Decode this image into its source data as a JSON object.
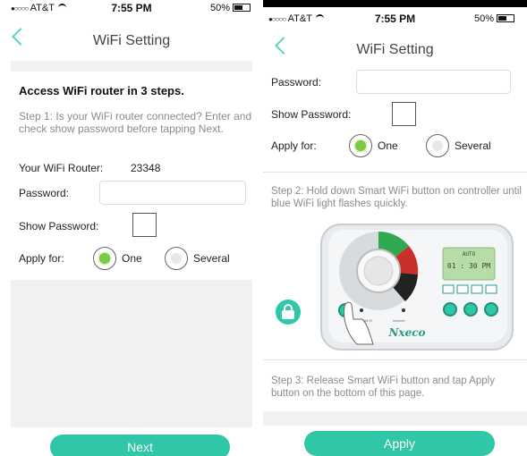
{
  "left": {
    "status": {
      "carrier": "AT&T",
      "time": "7:55 PM",
      "battery": "50%"
    },
    "title": "WiFi Setting",
    "heading": "Access WiFi router in 3 steps.",
    "step1": "Step 1: Is your WiFi router connected? Enter and check show password before tapping Next.",
    "router_label": "Your WiFi Router:",
    "router_value": "23348",
    "password_label": "Password:",
    "password_value": "",
    "show_password_label": "Show Password:",
    "apply_for_label": "Apply for:",
    "option_one": "One",
    "option_several": "Several",
    "selected": "One",
    "next_button": "Next"
  },
  "right": {
    "status": {
      "carrier": "AT&T",
      "time": "7:55 PM",
      "battery": "50%"
    },
    "title": "WiFi Setting",
    "password_label": "Password:",
    "password_value": "",
    "show_password_label": "Show Password:",
    "apply_for_label": "Apply for:",
    "option_one": "One",
    "option_several": "Several",
    "selected": "One",
    "step2": "Step 2: Hold down Smart WiFi button on controller until blue WiFi light flashes quickly.",
    "step3": "Step 3: Release Smart WiFi button and tap Apply button on the bottom of this page.",
    "apply_button": "Apply",
    "controller": {
      "brand": "Nxeco",
      "lcd_line1": "AUTO",
      "lcd_time": "01 : 30  PM",
      "smart_wifi_label": "Smart Wi-Fi",
      "internet_label": "Internet"
    }
  },
  "colors": {
    "accent": "#2fc7a6",
    "back_chevron": "#5fd1c0",
    "radio_selected": "#7ac942",
    "panel_gray": "#f1f1f1",
    "hint_text": "#8b8b8b"
  }
}
